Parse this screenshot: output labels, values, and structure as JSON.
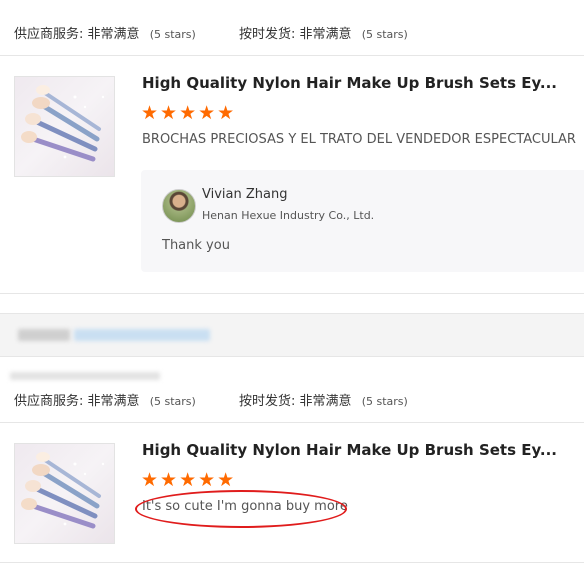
{
  "top_ratings": {
    "supplier_service_label": "供应商服务:",
    "supplier_service_value": "非常满意",
    "supplier_service_stars": "(5 stars)",
    "shipping_label": "按时发货:",
    "shipping_value": "非常满意",
    "shipping_stars": "(5 stars)"
  },
  "review1": {
    "product_title": "High Quality Nylon Hair Make Up Brush Sets Ey...",
    "stars": "★★★★★",
    "text": "BROCHAS PRECIOSAS Y EL TRATO DEL VENDEDOR ESPECTACULAR",
    "reply": {
      "name": "Vivian Zhang",
      "company": "Henan Hexue Industry Co., Ltd.",
      "text": "Thank you"
    }
  },
  "bottom_ratings": {
    "supplier_service_label": "供应商服务:",
    "supplier_service_value": "非常满意",
    "supplier_service_stars": "(5 stars)",
    "shipping_label": "按时发货:",
    "shipping_value": "非常满意",
    "shipping_stars": "(5 stars)"
  },
  "review2": {
    "product_title": "High Quality Nylon Hair Make Up Brush Sets Ey...",
    "stars": "★★★★★",
    "text": "It's so cute I'm gonna buy more"
  },
  "colors": {
    "star": "#ff6a00",
    "highlight_oval": "#e01c1c",
    "band": "#f4f4f4"
  },
  "icons": [
    "brush-set-product-thumbnail",
    "vendor-avatar"
  ]
}
